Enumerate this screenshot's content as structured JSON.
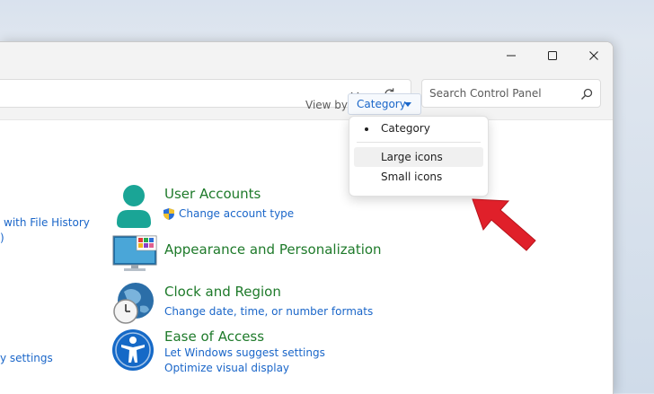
{
  "window": {
    "controls": {
      "minimize": "minimize",
      "maximize": "maximize",
      "close": "close"
    }
  },
  "toolbar": {
    "address_value": "",
    "search": {
      "placeholder": "Search Control Panel"
    }
  },
  "view_by": {
    "label": "View by:",
    "selected": "Category",
    "options": [
      {
        "label": "Category",
        "checked": true
      },
      {
        "label": "Large icons",
        "hovered": true
      },
      {
        "label": "Small icons"
      }
    ]
  },
  "left_column": {
    "links": [
      "with File History",
      ")",
      "y settings"
    ]
  },
  "categories": [
    {
      "title": "User Accounts",
      "icon": "user-icon",
      "links": [
        {
          "label": "Change account type",
          "icon": "uac-shield-icon"
        }
      ]
    },
    {
      "title": "Appearance and Personalization",
      "icon": "monitor-icon",
      "links": []
    },
    {
      "title": "Clock and Region",
      "icon": "clock-globe-icon",
      "links": [
        {
          "label": "Change date, time, or number formats"
        }
      ]
    },
    {
      "title": "Ease of Access",
      "icon": "accessibility-icon",
      "links": [
        {
          "label": "Let Windows suggest settings"
        },
        {
          "label": "Optimize visual display"
        }
      ]
    }
  ],
  "colors": {
    "category_title": "#1e7a2a",
    "link": "#1a66c9",
    "annotation_arrow": "#e0202a"
  }
}
